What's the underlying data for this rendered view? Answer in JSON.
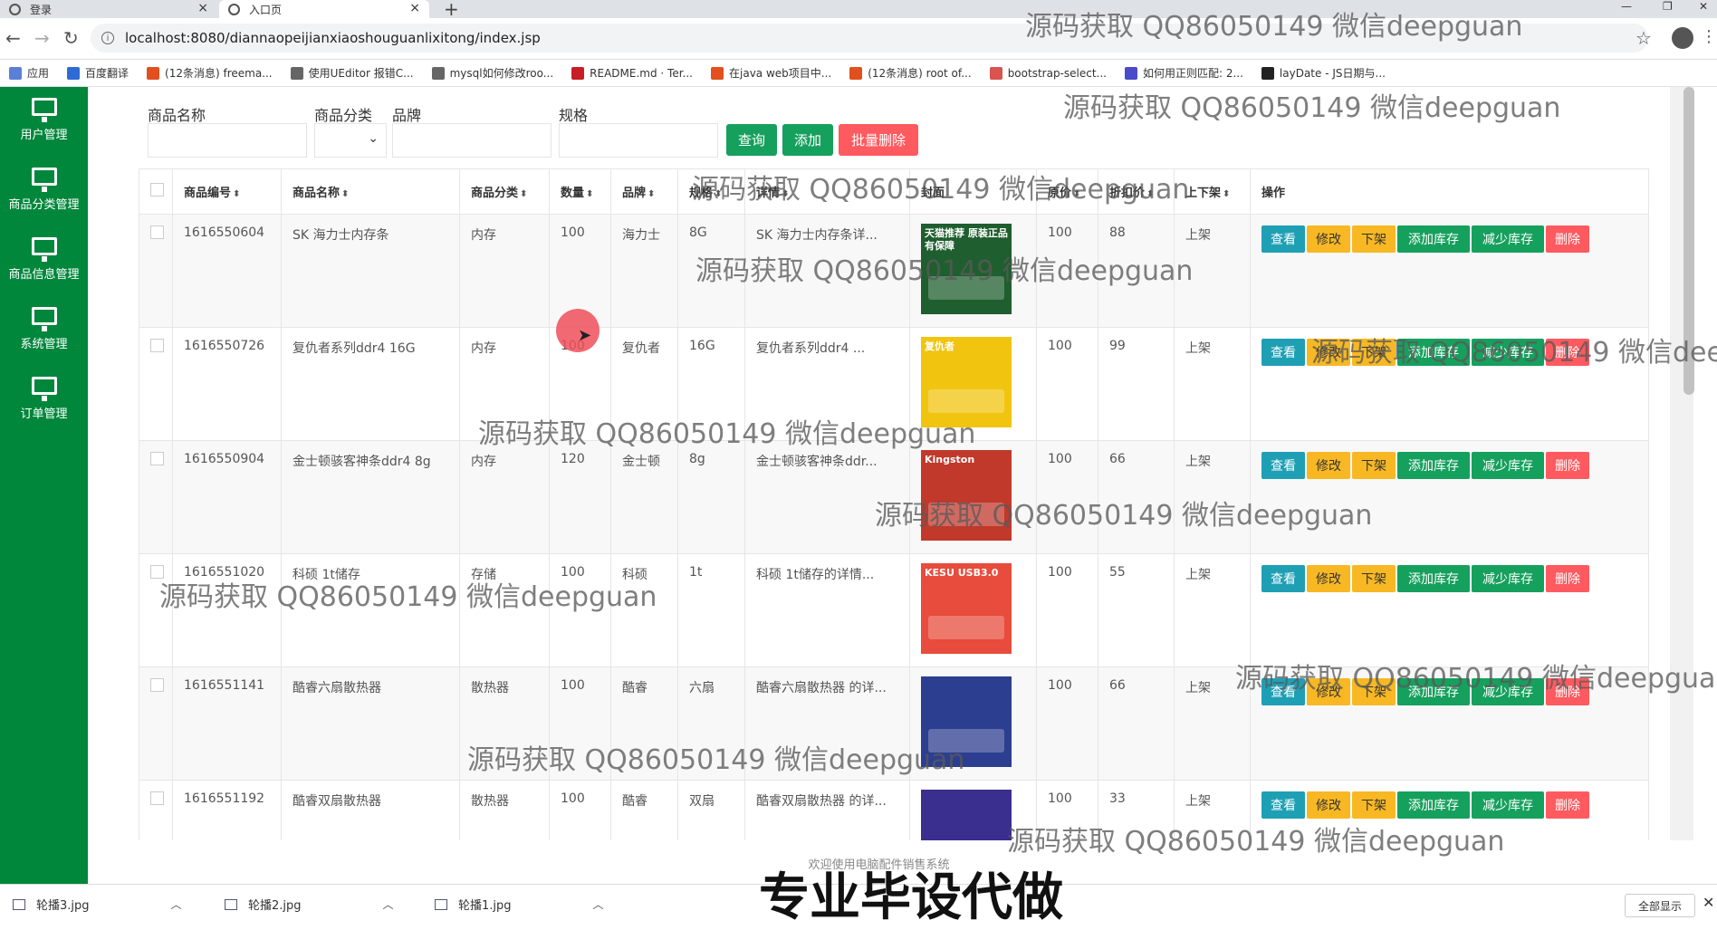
{
  "browser": {
    "tabs": [
      {
        "label": "登录",
        "active": false
      },
      {
        "label": "入口页",
        "active": true
      }
    ],
    "url": "localhost:8080/diannaopeijianxiaoshouguanlixitong/index.jsp",
    "bookmarks": [
      {
        "label": "应用",
        "color": "#5b7fd6"
      },
      {
        "label": "百度翻译",
        "color": "#2e6bd6"
      },
      {
        "label": "(12条消息) freema...",
        "color": "#e1501e"
      },
      {
        "label": "使用UEditor 报错C...",
        "color": "#666666"
      },
      {
        "label": "mysql如何修改roo...",
        "color": "#666666"
      },
      {
        "label": "README.md · Ter...",
        "color": "#c71d23"
      },
      {
        "label": "在java web项目中...",
        "color": "#e1501e"
      },
      {
        "label": "(12条消息) root of...",
        "color": "#e1501e"
      },
      {
        "label": "bootstrap-select...",
        "color": "#d9534f"
      },
      {
        "label": "如何用正则匹配: 2...",
        "color": "#4a4acb"
      },
      {
        "label": "layDate - JS日期与...",
        "color": "#222222"
      }
    ]
  },
  "sidebar": {
    "items": [
      {
        "label": "用户管理"
      },
      {
        "label": "商品分类管理"
      },
      {
        "label": "商品信息管理"
      },
      {
        "label": "系统管理"
      },
      {
        "label": "订单管理"
      }
    ]
  },
  "search": {
    "name_label": "商品名称",
    "category_label": "商品分类",
    "brand_label": "品牌",
    "spec_label": "规格",
    "query_button": "查询",
    "add_button": "添加",
    "batch_delete_button": "批量删除"
  },
  "table": {
    "headers": [
      "商品编号",
      "商品名称",
      "商品分类",
      "数量",
      "品牌",
      "规格",
      "详情",
      "封面",
      "原价",
      "折扣价",
      "上下架",
      "操作"
    ],
    "sortable": [
      true,
      true,
      true,
      true,
      true,
      true,
      true,
      false,
      true,
      true,
      true,
      false
    ],
    "actions": [
      "查看",
      "修改",
      "下架",
      "添加库存",
      "减少库存",
      "删除"
    ],
    "rows": [
      {
        "id": "1616550604",
        "name": "SK 海力士内存条",
        "category": "内存",
        "qty": "100",
        "brand": "海力士",
        "spec": "8G",
        "detail": "SK 海力士内存条详...",
        "price": "100",
        "discount": "88",
        "status": "上架",
        "cover_color": "#1f5e2e"
      },
      {
        "id": "1616550726",
        "name": "复仇者系列ddr4 16G",
        "category": "内存",
        "qty": "100",
        "brand": "复仇者",
        "spec": "16G",
        "detail": "复仇者系列ddr4 ...",
        "price": "100",
        "discount": "99",
        "status": "上架",
        "cover_color": "#f1c40f"
      },
      {
        "id": "1616550904",
        "name": "金士顿骇客神条ddr4 8g",
        "category": "内存",
        "qty": "120",
        "brand": "金士顿",
        "spec": "8g",
        "detail": "金士顿骇客神条ddr...",
        "price": "100",
        "discount": "66",
        "status": "上架",
        "cover_color": "#c0392b"
      },
      {
        "id": "1616551020",
        "name": "科硕 1t储存",
        "category": "存储",
        "qty": "100",
        "brand": "科硕",
        "spec": "1t",
        "detail": "科硕 1t储存的详情...",
        "price": "100",
        "discount": "55",
        "status": "上架",
        "cover_color": "#e74c3c"
      },
      {
        "id": "1616551141",
        "name": "酷睿六扇散热器",
        "category": "散热器",
        "qty": "100",
        "brand": "酷睿",
        "spec": "六扇",
        "detail": "酷睿六扇散热器 的详...",
        "price": "100",
        "discount": "66",
        "status": "上架",
        "cover_color": "#2c3e8f"
      },
      {
        "id": "1616551192",
        "name": "酷睿双扇散热器",
        "category": "散热器",
        "qty": "100",
        "brand": "酷睿",
        "spec": "双扇",
        "detail": "酷睿双扇散热器 的详...",
        "price": "100",
        "discount": "33",
        "status": "上架",
        "cover_color": "#3a2f8f"
      }
    ]
  },
  "cover_labels": {
    "row0": "天猫推荐 原装正品有保障",
    "row1": "复仇者",
    "row2": "Kingston",
    "row3": "KESU USB3.0",
    "row4": "",
    "row5": ""
  },
  "footer": {
    "text": "欢迎使用电脑配件销售系统"
  },
  "downloads": {
    "files": [
      "轮播3.jpg",
      "轮播2.jpg",
      "轮播1.jpg"
    ],
    "show_all": "全部显示"
  },
  "overlay": {
    "watermark": "源码获取 QQ86050149 微信deepguan",
    "caption": "专业毕设代做"
  },
  "colors": {
    "sidebar": "#00873c",
    "btn_view": "#1e9fb4",
    "btn_edit": "#f7b824",
    "btn_add": "#16a05d",
    "btn_delete": "#ff5a5f"
  }
}
